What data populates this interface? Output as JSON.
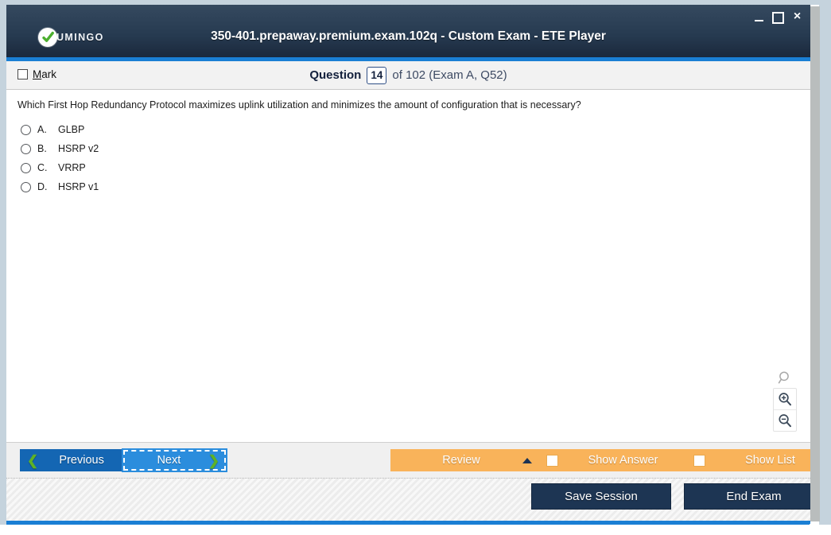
{
  "window": {
    "title": "350-401.prepaway.premium.exam.102q - Custom Exam - ETE Player",
    "logo_text": "UMINGO",
    "controls": {
      "minimize": "minimize-icon",
      "maximize": "maximize-icon",
      "close": "×"
    }
  },
  "question_header": {
    "mark_label_accel": "M",
    "mark_label_rest": "ark",
    "question_word": "Question",
    "question_number": "14",
    "of_text": "of 102 (Exam A, Q52)"
  },
  "content": {
    "question_text": "Which First Hop Redundancy Protocol maximizes uplink utilization and minimizes the amount of configuration that is necessary?",
    "options": [
      {
        "letter": "A.",
        "text": "GLBP",
        "selected": false
      },
      {
        "letter": "B.",
        "text": "HSRP v2",
        "selected": false
      },
      {
        "letter": "C.",
        "text": "VRRP",
        "selected": false
      },
      {
        "letter": "D.",
        "text": "HSRP v1",
        "selected": false
      }
    ],
    "zoom_tools": [
      {
        "name": "search-icon"
      },
      {
        "name": "zoom-in-icon"
      },
      {
        "name": "zoom-out-icon"
      }
    ]
  },
  "buttons": {
    "previous": "Previous",
    "next": "Next",
    "review": "Review",
    "show_answer": "Show Answer",
    "show_list": "Show List",
    "save_session": "Save Session",
    "end_exam": "End Exam"
  },
  "colors": {
    "titlebar_dark": "#2d4157",
    "accent_blue": "#1a7fd4",
    "previous_blue": "#1466b3",
    "next_blue": "#2b8ddd",
    "orange": "#f9b35a",
    "dark_navy": "#1d3553",
    "chevron_green": "#5eb226",
    "logo_green": "#4caf2f"
  }
}
